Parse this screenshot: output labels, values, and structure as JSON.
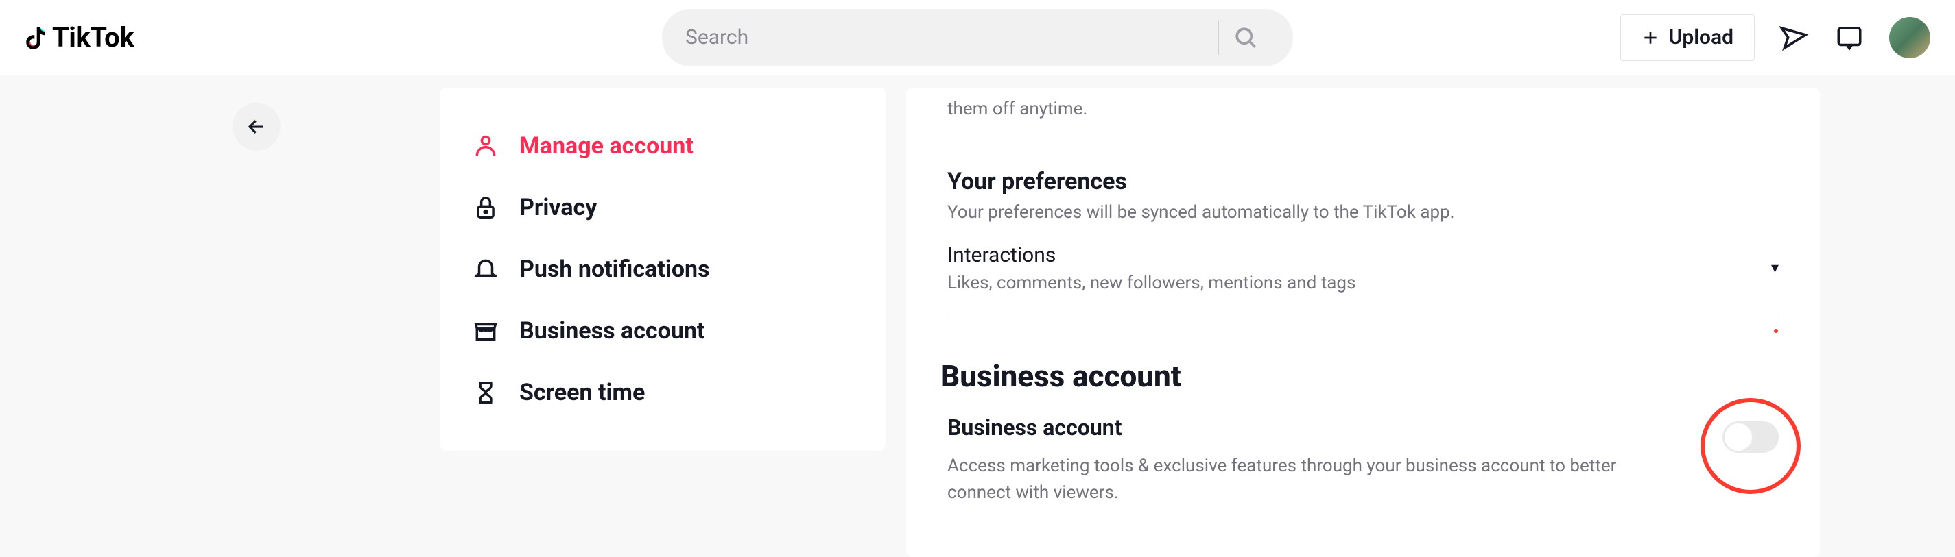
{
  "header": {
    "logo_text": "TikTok",
    "search_placeholder": "Search",
    "upload_label": "Upload"
  },
  "sidebar": {
    "items": [
      {
        "label": "Manage account",
        "icon": "user-icon",
        "active": true
      },
      {
        "label": "Privacy",
        "icon": "lock-icon",
        "active": false
      },
      {
        "label": "Push notifications",
        "icon": "bell-icon",
        "active": false
      },
      {
        "label": "Business account",
        "icon": "storefront-icon",
        "active": false
      },
      {
        "label": "Screen time",
        "icon": "hourglass-icon",
        "active": false
      }
    ]
  },
  "main": {
    "truncated_top": "them off anytime.",
    "preferences": {
      "title": "Your preferences",
      "subtitle": "Your preferences will be synced automatically to the TikTok app."
    },
    "interactions": {
      "title": "Interactions",
      "desc": "Likes, comments, new followers, mentions and tags"
    },
    "business": {
      "heading": "Business account",
      "item_title": "Business account",
      "item_desc": "Access marketing tools & exclusive features through your business account to better connect with viewers.",
      "toggle_on": false
    }
  }
}
